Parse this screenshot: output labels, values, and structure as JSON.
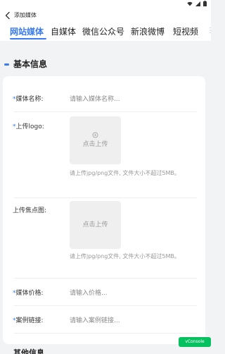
{
  "nav": {
    "title": "添加媒体"
  },
  "tabs": [
    {
      "label": "网站媒体",
      "active": true
    },
    {
      "label": "自媒体",
      "active": false
    },
    {
      "label": "微信公众号",
      "active": false
    },
    {
      "label": "新浪微博",
      "active": false
    },
    {
      "label": "短视频",
      "active": false
    }
  ],
  "section": {
    "title": "基本信息"
  },
  "form": {
    "media_name": {
      "label": "媒体名称:",
      "placeholder": "请输入媒体名称..."
    },
    "logo": {
      "label": "上传logo:",
      "button": "点击上传",
      "hint": "请上传jpg/png文件, 文件大小不超过5MB。"
    },
    "focus_image": {
      "label": "上传焦点图:",
      "button": "点击上传",
      "hint": "请上传jpg/png文件, 文件大小不超过5MB。"
    },
    "price": {
      "label": "媒体价格:",
      "placeholder": "请输入价格..."
    },
    "case_link": {
      "label": "案例链接:",
      "placeholder": "请输入案例链接..."
    },
    "required_mark": "*"
  },
  "next_section": {
    "title": "其他信息"
  },
  "vconsole": {
    "label": "vConsole"
  },
  "colors": {
    "accent": "#3a7af0",
    "vconsole": "#07c160"
  }
}
